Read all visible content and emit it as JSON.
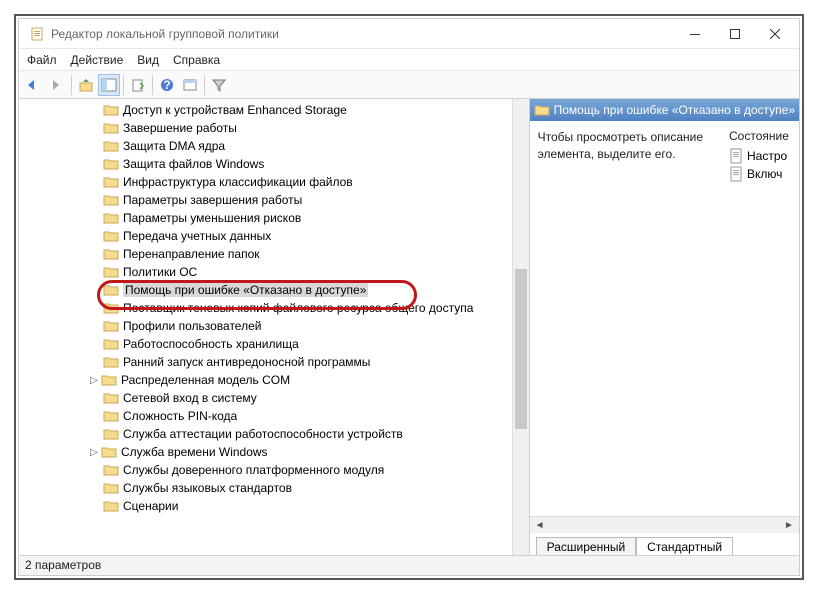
{
  "window": {
    "title": "Редактор локальной групповой политики"
  },
  "menu": {
    "file": "Файл",
    "action": "Действие",
    "view": "Вид",
    "help": "Справка"
  },
  "tree": {
    "items": [
      {
        "label": "Доступ к устройствам Enhanced Storage",
        "expandable": false
      },
      {
        "label": "Завершение работы",
        "expandable": false
      },
      {
        "label": "Защита DMA ядра",
        "expandable": false
      },
      {
        "label": "Защита файлов Windows",
        "expandable": false
      },
      {
        "label": "Инфраструктура классификации файлов",
        "expandable": false
      },
      {
        "label": "Параметры завершения работы",
        "expandable": false
      },
      {
        "label": "Параметры уменьшения рисков",
        "expandable": false
      },
      {
        "label": "Передача учетных данных",
        "expandable": false
      },
      {
        "label": "Перенаправление папок",
        "expandable": false
      },
      {
        "label": "Политики ОС",
        "expandable": false
      },
      {
        "label": "Помощь при ошибке «Отказано в доступе»",
        "expandable": false,
        "selected": true,
        "highlighted": true
      },
      {
        "label": "Поставщик теневых копий файлового ресурса общего доступа",
        "expandable": false
      },
      {
        "label": "Профили пользователей",
        "expandable": false
      },
      {
        "label": "Работоспособность хранилища",
        "expandable": false
      },
      {
        "label": "Ранний запуск антивредоносной программы",
        "expandable": false
      },
      {
        "label": "Распределенная модель COM",
        "expandable": true
      },
      {
        "label": "Сетевой вход в систему",
        "expandable": false
      },
      {
        "label": "Сложность PIN-кода",
        "expandable": false
      },
      {
        "label": "Служба аттестации работоспособности устройств",
        "expandable": false
      },
      {
        "label": "Служба времени Windows",
        "expandable": true
      },
      {
        "label": "Службы доверенного платформенного модуля",
        "expandable": false
      },
      {
        "label": "Службы языковых стандартов",
        "expandable": false
      },
      {
        "label": "Сценарии",
        "expandable": false
      }
    ]
  },
  "right": {
    "header": "Помощь при ошибке «Отказано в доступе»",
    "description": "Чтобы просмотреть описание элемента, выделите его.",
    "col_header": "Состояние",
    "items": [
      {
        "label": "Настро"
      },
      {
        "label": "Включ"
      }
    ]
  },
  "tabs": {
    "extended": "Расширенный",
    "standard": "Стандартный"
  },
  "status": "2 параметров"
}
